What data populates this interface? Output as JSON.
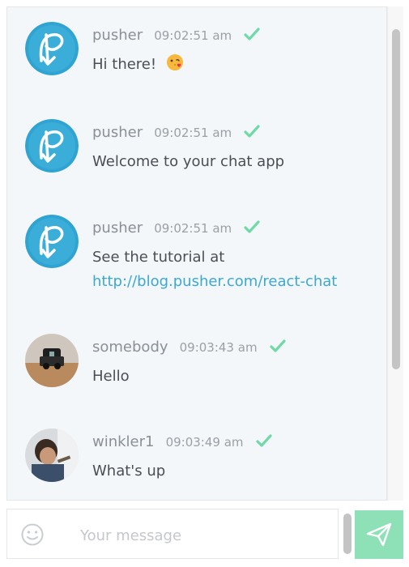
{
  "messages": [
    {
      "author": "pusher",
      "time": "09:02:51 am",
      "text": "Hi there!",
      "avatar": "pusher-logo",
      "emoji": "kiss-emoji"
    },
    {
      "author": "pusher",
      "time": "09:02:51 am",
      "text": "Welcome to your chat app",
      "avatar": "pusher-logo"
    },
    {
      "author": "pusher",
      "time": "09:02:51 am",
      "text": "See the tutorial at",
      "link": "http://blog.pusher.com/react-chat",
      "avatar": "pusher-logo"
    },
    {
      "author": "somebody",
      "time": "09:03:43 am",
      "text": "Hello",
      "avatar": "photo"
    },
    {
      "author": "winkler1",
      "time": "09:03:49 am",
      "text": "What's up",
      "avatar": "photo"
    }
  ],
  "composer": {
    "placeholder": "Your message",
    "send_icon": "paper-plane-icon",
    "emoji_icon": "smiley-icon"
  },
  "colors": {
    "panel_bg": "#f4f7f9",
    "pusher_blue": "#2fa3d1",
    "check_green": "#6fd9a8",
    "link": "#3ca8d2",
    "send_bg": "#8ee0b6"
  }
}
